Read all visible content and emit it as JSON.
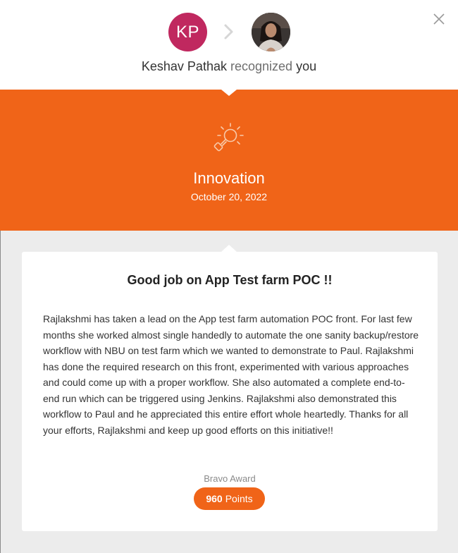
{
  "header": {
    "giver_initials": "KP",
    "giver_name": "Keshav Pathak",
    "verb": "recognized",
    "receiver": "you"
  },
  "award": {
    "name": "Innovation",
    "date": "October 20, 2022",
    "icon": "lightbulb-icon"
  },
  "message": {
    "title": "Good job on App Test farm POC !!",
    "body": "Rajlakshmi has taken a lead on the App test farm automation POC front. For last few months she worked almost single handedly to automate the one sanity backup/restore workflow with NBU on test farm which we wanted to demonstrate to Paul. Rajlakshmi has done the required research on this front, experimented with various approaches and could come up with a proper workflow. She also automated a complete end-to-end run which can be triggered using Jenkins. Rajlakshmi also demonstrated this workflow to Paul and he appreciated this entire effort whole heartedly. Thanks for all your efforts, Rajlakshmi and keep up good efforts on this initiative!!"
  },
  "reward": {
    "type": "Bravo Award",
    "points_value": "960",
    "points_label": "Points"
  },
  "colors": {
    "accent": "#f06418",
    "avatar_bg": "#c0285f",
    "page_bg": "#ececec"
  }
}
